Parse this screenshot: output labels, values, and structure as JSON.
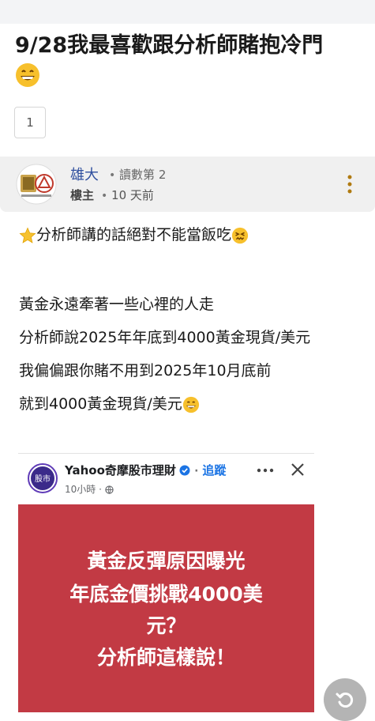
{
  "post": {
    "title": "9/28我最喜歡跟分析師賭抱冷門",
    "title_emoji": "grinning-face-emoji",
    "page_number": "1"
  },
  "author": {
    "name": "雄大",
    "read_count": "讀數第 2",
    "role": "樓主",
    "time_ago": "10 天前",
    "avatar_icon": "recycle-emblem-avatar"
  },
  "content": {
    "lines": [
      "分析師講的話絕對不能當飯吃",
      "黃金永遠牽著一些心裡的人走",
      "分析師說2025年年底到4000黃金現貨/美元",
      "我偏偏跟你賭不用到2025年10月底前",
      "就到4000黃金現貨/美元"
    ],
    "icons": [
      "star-emoji",
      "confounded-face-emoji",
      "grinning-face-emoji"
    ]
  },
  "embedded_post": {
    "page_name": "Yahoo奇摩股市理財",
    "logo_text": "股市",
    "follow_label": "追蹤",
    "time": "10小時",
    "headline_lines": [
      "黃金反彈原因曝光",
      "年底金價挑戰4000美",
      "元？",
      "分析師這樣說！"
    ],
    "colors": {
      "banner_bg": "#c23a44",
      "follow": "#1b74e4",
      "logo_bg": "#3b2a8a"
    }
  },
  "fab": {
    "icon": "refresh-icon"
  }
}
